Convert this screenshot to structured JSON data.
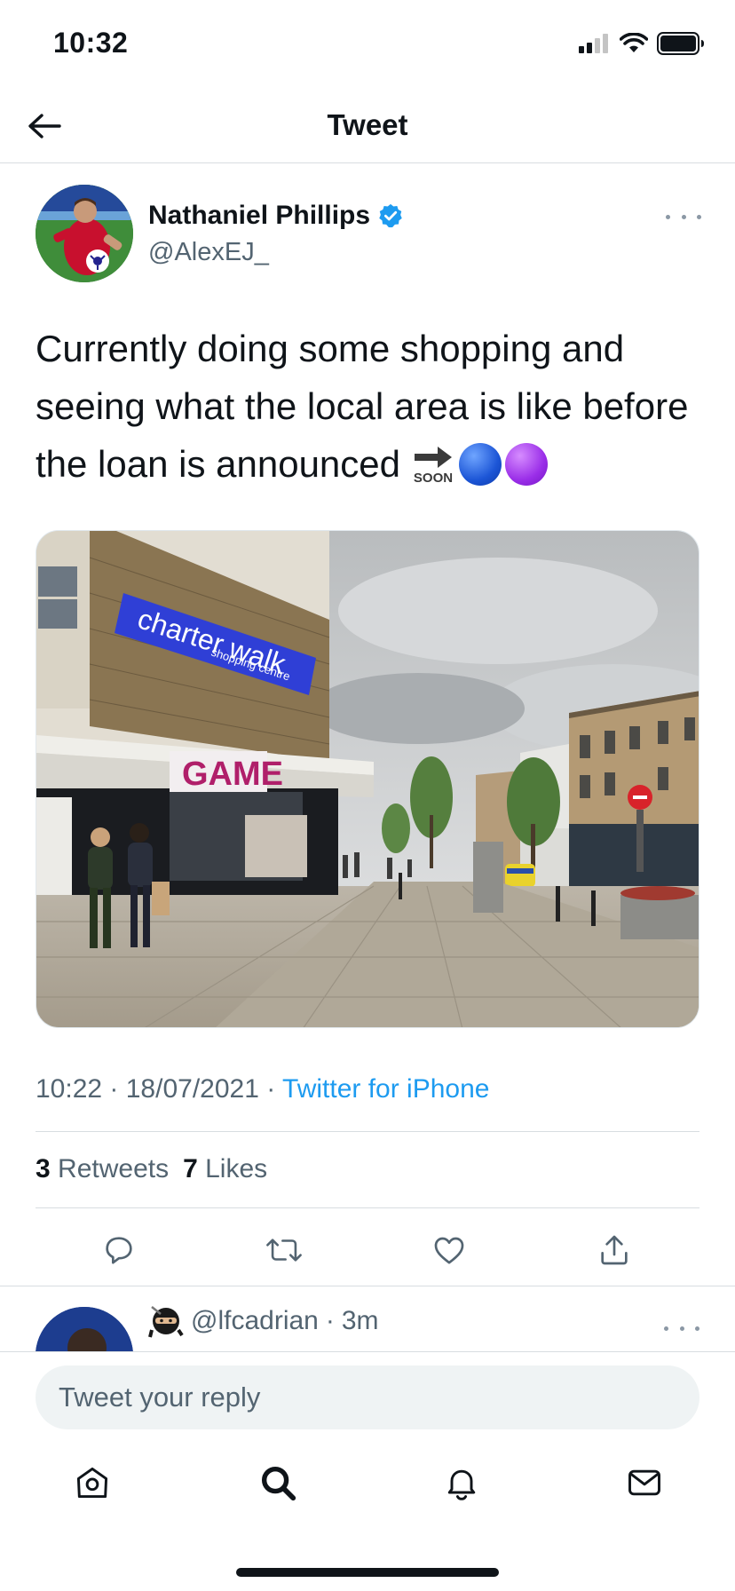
{
  "status_bar": {
    "time": "10:32",
    "icons": [
      "signal-icon",
      "wifi-icon",
      "battery-icon"
    ]
  },
  "nav": {
    "title": "Tweet",
    "back_icon": "arrow-left-icon"
  },
  "tweet": {
    "author_name": "Nathaniel Phillips",
    "author_handle": "@AlexEJ_",
    "verified_icon": "verified-badge-icon",
    "text": "Currently doing some shopping and seeing what the local area is like before the loan is announced ",
    "emoji": [
      "soon-arrow-emoji",
      "blue-circle-emoji",
      "purple-circle-emoji"
    ],
    "emoji_soon_label": "SOON",
    "media": {
      "sign_main": "charter walk",
      "sign_sub": "shopping centre",
      "store_sign": "GAME"
    },
    "time": "10:22",
    "date": "18/07/2021",
    "source": "Twitter for iPhone",
    "retweets_count": "3",
    "retweets_label": "Retweets",
    "likes_count": "7",
    "likes_label": "Likes"
  },
  "actions": [
    "reply-icon",
    "retweet-icon",
    "like-icon",
    "share-icon"
  ],
  "reply_preview": {
    "handle": "@lfcadrian",
    "time": "3m",
    "separator": "·"
  },
  "composer": {
    "placeholder": "Tweet your reply"
  },
  "tabbar": [
    "home-icon",
    "search-icon",
    "notifications-icon",
    "messages-icon"
  ],
  "colors": {
    "accent": "#1d9bf0",
    "text": "#0f1419",
    "secondary": "#536471",
    "divider": "#d8dde1"
  }
}
